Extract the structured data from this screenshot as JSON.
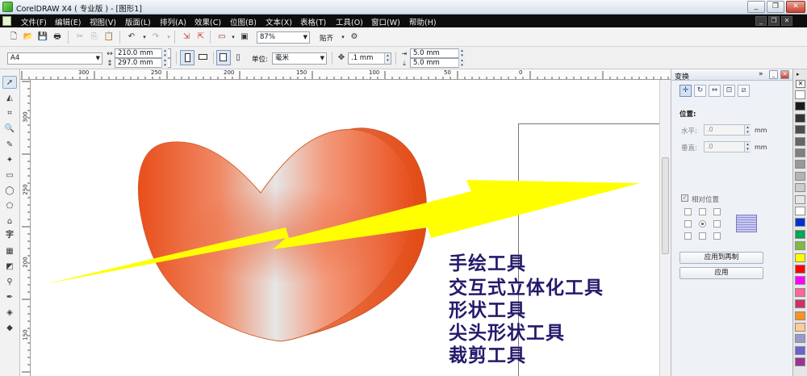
{
  "window": {
    "title": "CorelDRAW X4 ( 专业版 ) - [图形1]",
    "minimize": "_",
    "restore": "❐",
    "close": "✕"
  },
  "menu": {
    "items": [
      "文件(F)",
      "编辑(E)",
      "视图(V)",
      "版面(L)",
      "排列(A)",
      "效果(C)",
      "位图(B)",
      "文本(X)",
      "表格(T)",
      "工具(O)",
      "窗口(W)",
      "帮助(H)"
    ],
    "doc_min": "_",
    "doc_restore": "❐",
    "doc_close": "✕"
  },
  "toolbar_standard": {
    "zoom_value": "87%",
    "snap_label": "贴齐"
  },
  "toolbar_property": {
    "paper_value": "A4",
    "width_value": "210.0 mm",
    "height_value": "297.0 mm",
    "units_label": "单位:",
    "units_value": "毫米",
    "nudge_value": ".1 mm",
    "dup_x_value": "5.0 mm",
    "dup_y_value": "5.0 mm"
  },
  "rulers": {
    "horizontal": [
      "300",
      "250",
      "200",
      "150",
      "100",
      "50",
      "0"
    ],
    "vertical": [
      "300",
      "250",
      "200",
      "150"
    ]
  },
  "canvas": {
    "captions": [
      "手绘工具",
      "交互式立体化工具",
      "形状工具",
      "尖头形状工具",
      "裁剪工具"
    ],
    "caption_color": "#231a6b",
    "arrow_color": "#ffff00",
    "heart_colors": [
      "#e94e1b",
      "#f4a58a",
      "#e6e6e6"
    ]
  },
  "docker": {
    "title": "变换",
    "position_section": "位置:",
    "h_label": "水平:",
    "h_value": ".0",
    "v_label": "垂直:",
    "v_value": ".0",
    "unit": "mm",
    "relative_label": "相对位置",
    "apply_dup_label": "应用到再制",
    "apply_label": "应用",
    "collapse_icon": "»"
  },
  "palette": {
    "colors": [
      "#ffffff",
      "#1a1a1a",
      "#333333",
      "#4d4d4d",
      "#666666",
      "#808080",
      "#999999",
      "#b3b3b3",
      "#cccccc",
      "#e6e6e6",
      "#ffffff",
      "#0033cc",
      "#00a651",
      "#7fba42",
      "#ffff00",
      "#ff0000",
      "#ff00ff",
      "#ff6699",
      "#cc3366",
      "#f7941d",
      "#ffcc99",
      "#9999cc",
      "#6666cc",
      "#993399"
    ]
  }
}
